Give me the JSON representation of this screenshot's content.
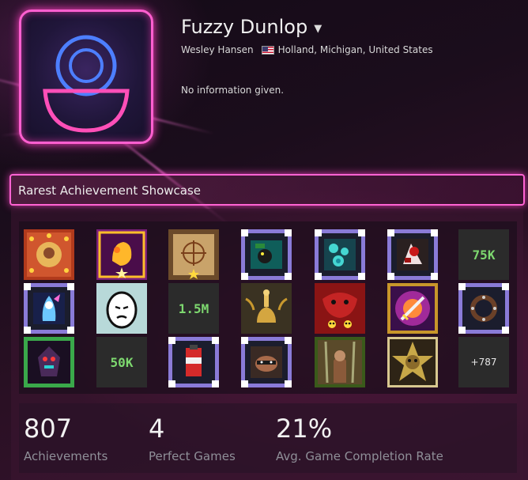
{
  "profile": {
    "persona_name": "Fuzzy Dunlop",
    "real_name": "Wesley Hansen",
    "location": "Holland, Michigan, United States",
    "summary": "No information given."
  },
  "showcase": {
    "title": "Rarest Achievement Showcase",
    "tiles": [
      {
        "icon": "army-insignia-icon"
      },
      {
        "icon": "golden-fist-icon"
      },
      {
        "icon": "treasure-map-icon"
      },
      {
        "icon": "frog-scene-icon"
      },
      {
        "icon": "teal-crystals-icon"
      },
      {
        "icon": "bloody-warrior-icon"
      },
      {
        "icon": "text",
        "text": "75K"
      },
      {
        "icon": "blue-spirit-icon"
      },
      {
        "icon": "egg-face-icon"
      },
      {
        "icon": "text",
        "text": "1.5M"
      },
      {
        "icon": "golden-lamp-icon"
      },
      {
        "icon": "red-demon-skulls-icon"
      },
      {
        "icon": "purple-sword-icon"
      },
      {
        "icon": "brown-ring-icon"
      },
      {
        "icon": "dark-robot-icon"
      },
      {
        "icon": "text",
        "text": "50K"
      },
      {
        "icon": "red-bottle-icon"
      },
      {
        "icon": "raccoon-icon"
      },
      {
        "icon": "armored-soldier-icon"
      },
      {
        "icon": "golden-star-badge-icon"
      },
      {
        "icon": "more",
        "text": "+787"
      }
    ]
  },
  "stats": [
    {
      "value": "807",
      "label": "Achievements"
    },
    {
      "value": "4",
      "label": "Perfect Games"
    },
    {
      "value": "21%",
      "label": "Avg. Game Completion Rate"
    }
  ],
  "colors": {
    "neon_pink": "#ff5fd0",
    "stat_label": "#8f8f98",
    "tile_text_green": "#7dd86f"
  }
}
